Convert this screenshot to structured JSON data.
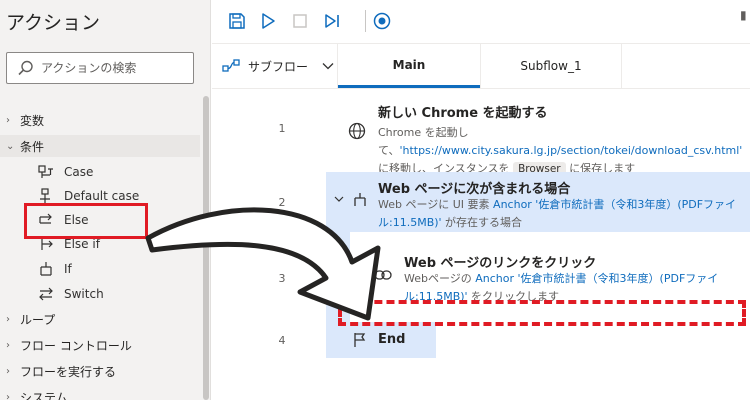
{
  "actions_pane": {
    "title": "アクション",
    "search": {
      "placeholder": "アクションの検索"
    },
    "groups": [
      {
        "label": "変数",
        "expanded": false
      },
      {
        "label": "条件",
        "expanded": true,
        "items": [
          "Case",
          "Default case",
          "Else",
          "Else if",
          "If",
          "Switch"
        ]
      },
      {
        "label": "ループ",
        "expanded": false
      },
      {
        "label": "フロー コントロール",
        "expanded": false
      },
      {
        "label": "フローを実行する",
        "expanded": false
      },
      {
        "label": "システム",
        "expanded": false
      }
    ]
  },
  "toolbar": {
    "icons": [
      "save-icon",
      "run-icon",
      "stop-icon",
      "run-next-action-icon",
      "record-icon"
    ]
  },
  "tabs": {
    "subflows_label": "サブフロー",
    "items": [
      "Main",
      "Subflow_1"
    ],
    "active": "Main"
  },
  "flow": {
    "steps": [
      {
        "line": "1",
        "title": "新しい Chrome を起動する",
        "desc_prefix": "Chrome を起動して、",
        "desc_link": "'https://www.city.sakura.lg.jp/section/tokei/download_csv.html'",
        "desc_mid": " に移動し、インスタンスを ",
        "desc_badge": "Browser",
        "desc_suffix": " に保存します"
      },
      {
        "line": "2",
        "title": "Web ページに次が含まれる場合",
        "desc_prefix": "Web ページに UI 要素 ",
        "desc_link": "Anchor '佐倉市統計書（令和3年度）(PDFファイル:11.5MB)'",
        "desc_suffix": " が存在する場合"
      },
      {
        "line": "3",
        "title": "Web ページのリンクをクリック",
        "desc_prefix": "Webページの ",
        "desc_link": "Anchor '佐倉市統計書（令和3年度）(PDFファイル:11.5MB)'",
        "desc_suffix": " をクリックします"
      },
      {
        "line": "4",
        "title": "End"
      }
    ]
  },
  "colors": {
    "accent": "#0f6cbd",
    "highlight": "#e01b24",
    "block_bg": "#dbe8fb"
  }
}
